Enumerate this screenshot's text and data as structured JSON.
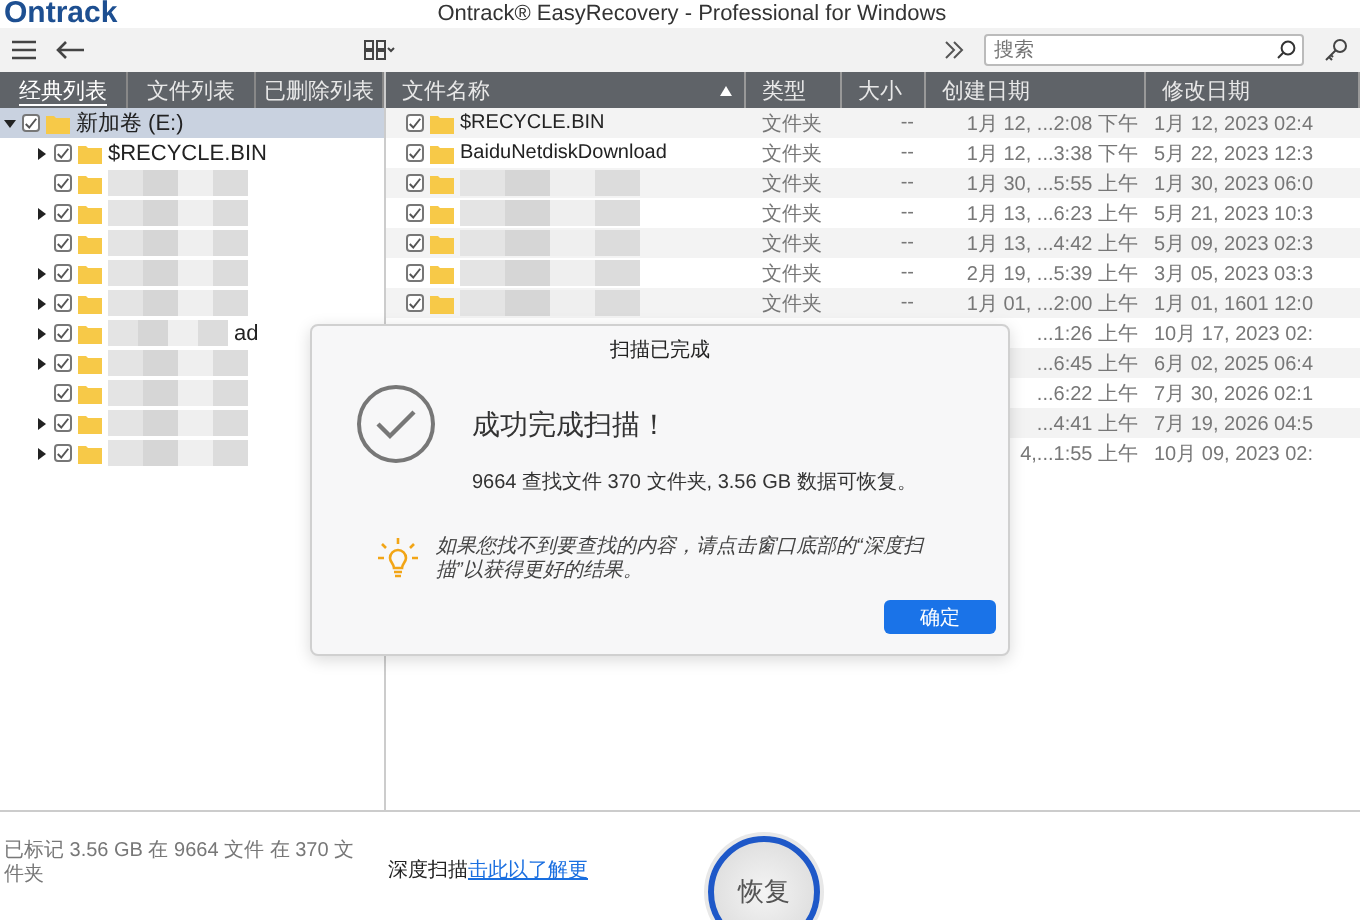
{
  "window": {
    "logo": "Ontrack",
    "title": "Ontrack® EasyRecovery - Professional for Windows"
  },
  "toolbar": {
    "search": {
      "placeholder": "搜索"
    }
  },
  "left_tabs": [
    {
      "label": "经典列表",
      "selected": true
    },
    {
      "label": "文件列表",
      "selected": false
    },
    {
      "label": "已删除列表",
      "selected": false
    }
  ],
  "tree": [
    {
      "name": "新加卷 (E:)",
      "checked": true,
      "expanded": true,
      "selected": true,
      "children": [
        {
          "name": "$RECYCLE.BIN",
          "checked": true,
          "expandable": true,
          "blurred": false
        },
        {
          "checked": true,
          "expandable": false,
          "blurred": true
        },
        {
          "checked": true,
          "expandable": true,
          "blurred": true
        },
        {
          "checked": true,
          "expandable": false,
          "blurred": true
        },
        {
          "checked": true,
          "expandable": true,
          "blurred": true
        },
        {
          "checked": true,
          "expandable": true,
          "blurred": true
        },
        {
          "name": "ad",
          "checked": true,
          "expandable": true,
          "blurred": true
        },
        {
          "checked": true,
          "expandable": true,
          "blurred": true
        },
        {
          "checked": true,
          "expandable": false,
          "blurred": true
        },
        {
          "checked": true,
          "expandable": true,
          "blurred": true
        },
        {
          "checked": true,
          "expandable": true,
          "blurred": true
        }
      ]
    }
  ],
  "table": {
    "columns": [
      {
        "label": "文件名称",
        "sorted": true
      },
      {
        "label": "类型",
        "sorted": false
      },
      {
        "label": "大小",
        "sorted": false
      },
      {
        "label": "创建日期",
        "sorted": false
      },
      {
        "label": "修改日期",
        "sorted": false
      }
    ],
    "rows": [
      {
        "name": "$RECYCLE.BIN",
        "blurred": false,
        "checked": true,
        "type": "文件夹",
        "size": "--",
        "created": "1月 12, ...2:08 下午",
        "modified": "1月 12, 2023 02:4"
      },
      {
        "name": "BaiduNetdiskDownload",
        "blurred": false,
        "checked": true,
        "type": "文件夹",
        "size": "--",
        "created": "1月 12, ...3:38 下午",
        "modified": "5月 22, 2023 12:3"
      },
      {
        "blurred": true,
        "checked": true,
        "type": "文件夹",
        "size": "--",
        "created": "1月 30, ...5:55 上午",
        "modified": "1月 30, 2023 06:0"
      },
      {
        "blurred": true,
        "checked": true,
        "type": "文件夹",
        "size": "--",
        "created": "1月 13, ...6:23 上午",
        "modified": "5月 21, 2023 10:3"
      },
      {
        "blurred": true,
        "checked": true,
        "type": "文件夹",
        "size": "--",
        "created": "1月 13, ...4:42 上午",
        "modified": "5月 09, 2023 02:3"
      },
      {
        "blurred": true,
        "checked": true,
        "type": "文件夹",
        "size": "--",
        "created": "2月 19, ...5:39 上午",
        "modified": "3月 05, 2023 03:3"
      },
      {
        "blurred": true,
        "checked": true,
        "type": "文件夹",
        "size": "--",
        "created": "1月 01, ...2:00 上午",
        "modified": "1月 01, 1601 12:0"
      },
      {
        "created": "...1:26 上午",
        "modified": "10月 17, 2023 02:"
      },
      {
        "created": "...6:45 上午",
        "modified": "6月 02, 2025 06:4"
      },
      {
        "created": "...6:22 上午",
        "modified": "7月 30, 2026 02:1"
      },
      {
        "created": "...4:41 上午",
        "modified": "7月 19, 2026 04:5"
      },
      {
        "created": "4,...1:55 上午",
        "modified": "10月 09, 2023 02:"
      }
    ]
  },
  "dialog": {
    "title": "扫描已完成",
    "heading": "成功完成扫描！",
    "summary": "9664 查找文件 370 文件夹, 3.56 GB 数据可恢复。",
    "tip": "如果您找不到要查找的内容，请点击窗口底部的“深度扫描”以获得更好的结果。",
    "ok_button": "确定"
  },
  "status_bar": {
    "marked": "已标记 3.56 GB 在 9664 文件 在 370 文件夹",
    "deep_scan_label": "深度扫描",
    "deep_scan_link": "击此以了解更",
    "recover_button": "恢复"
  }
}
